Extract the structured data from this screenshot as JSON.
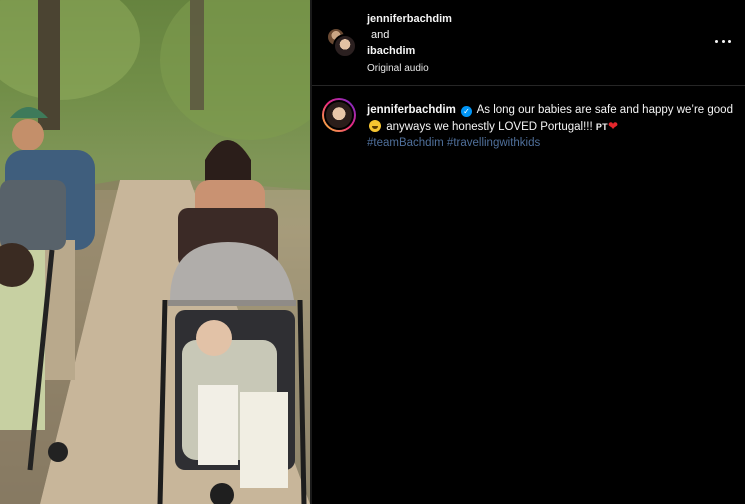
{
  "header": {
    "user1": "jenniferbachdim",
    "conjunction": "and",
    "user2": "ibachdim",
    "audio": "Original audio"
  },
  "caption": {
    "username": "jenniferbachdim",
    "verified_glyph": "✓",
    "text_part1": "As long our babies are safe and happy we’re good",
    "text_part2": "anyways we honestly LOVED Portugal!!!",
    "flag_text": "PT",
    "heart": "❤",
    "hashtags": [
      "#teamBachdim",
      "#travellingwithkids"
    ]
  },
  "icons": {
    "more": "more-horizontal-icon",
    "verified": "verified-badge-icon",
    "emoji": "grinning-sweat-emoji-icon"
  },
  "colors": {
    "background": "#000000",
    "hashtag": "#4f6f9a",
    "verified": "#0095f6",
    "heart": "#e4262c"
  }
}
